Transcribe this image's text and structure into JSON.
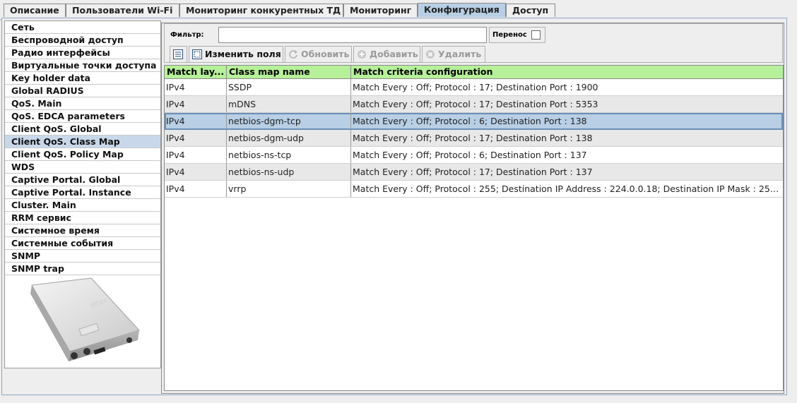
{
  "tabs": [
    {
      "label": "Описание"
    },
    {
      "label": "Пользователи Wi-Fi"
    },
    {
      "label": "Мониторинг конкурентных ТД"
    },
    {
      "label": "Мониторинг"
    },
    {
      "label": "Конфигурация"
    },
    {
      "label": "Доступ"
    }
  ],
  "active_tab": "Конфигурация",
  "sidebar": {
    "items": [
      {
        "label": "Сеть"
      },
      {
        "label": "Беспроводной доступ"
      },
      {
        "label": "Радио интерфейсы"
      },
      {
        "label": "Виртуальные точки доступа"
      },
      {
        "label": "Key holder data"
      },
      {
        "label": "Global RADIUS"
      },
      {
        "label": "QoS. Main"
      },
      {
        "label": "QoS. EDCA parameters"
      },
      {
        "label": "Client QoS. Global"
      },
      {
        "label": "Client QoS. Class Map"
      },
      {
        "label": "Client QoS. Policy Map"
      },
      {
        "label": "WDS"
      },
      {
        "label": "Captive Portal. Global"
      },
      {
        "label": "Captive Portal. Instance"
      },
      {
        "label": "Cluster. Main"
      },
      {
        "label": "RRM сервис"
      },
      {
        "label": "Системное время"
      },
      {
        "label": "Системные события"
      },
      {
        "label": "SNMP"
      },
      {
        "label": "SNMP trap"
      }
    ],
    "active_item": "Client QoS. Class Map",
    "device_brand": "eltex"
  },
  "filter": {
    "label": "Фильтр:",
    "value": ""
  },
  "wrap": {
    "label": "Перенос",
    "checked": false
  },
  "toolbar": {
    "edit_fields": "Изменить поля",
    "refresh": "Обновить",
    "add": "Добавить",
    "delete": "Удалить"
  },
  "table": {
    "headers": [
      "Match lay...",
      "Class map name",
      "Match criteria configuration"
    ],
    "rows": [
      [
        "IPv4",
        "SSDP",
        "Match Every : Off; Protocol : 17; Destination Port : 1900"
      ],
      [
        "IPv4",
        "mDNS",
        "Match Every : Off; Protocol : 17; Destination Port : 5353"
      ],
      [
        "IPv4",
        "netbios-dgm-tcp",
        "Match Every : Off; Protocol : 6; Destination Port : 138"
      ],
      [
        "IPv4",
        "netbios-dgm-udp",
        "Match Every : Off; Protocol : 17; Destination Port : 138"
      ],
      [
        "IPv4",
        "netbios-ns-tcp",
        "Match Every : Off; Protocol : 6; Destination Port : 137"
      ],
      [
        "IPv4",
        "netbios-ns-udp",
        "Match Every : Off; Protocol : 17; Destination Port : 137"
      ],
      [
        "IPv4",
        "vrrp",
        "Match Every : Off; Protocol : 255; Destination IP Address : 224.0.0.18; Destination IP Mask : 255..."
      ]
    ],
    "selected_row": 2
  },
  "colors": {
    "active_tab": "#b8cfe5",
    "header_bg": "#b6f098",
    "selected_row": "#b8cfe5"
  }
}
